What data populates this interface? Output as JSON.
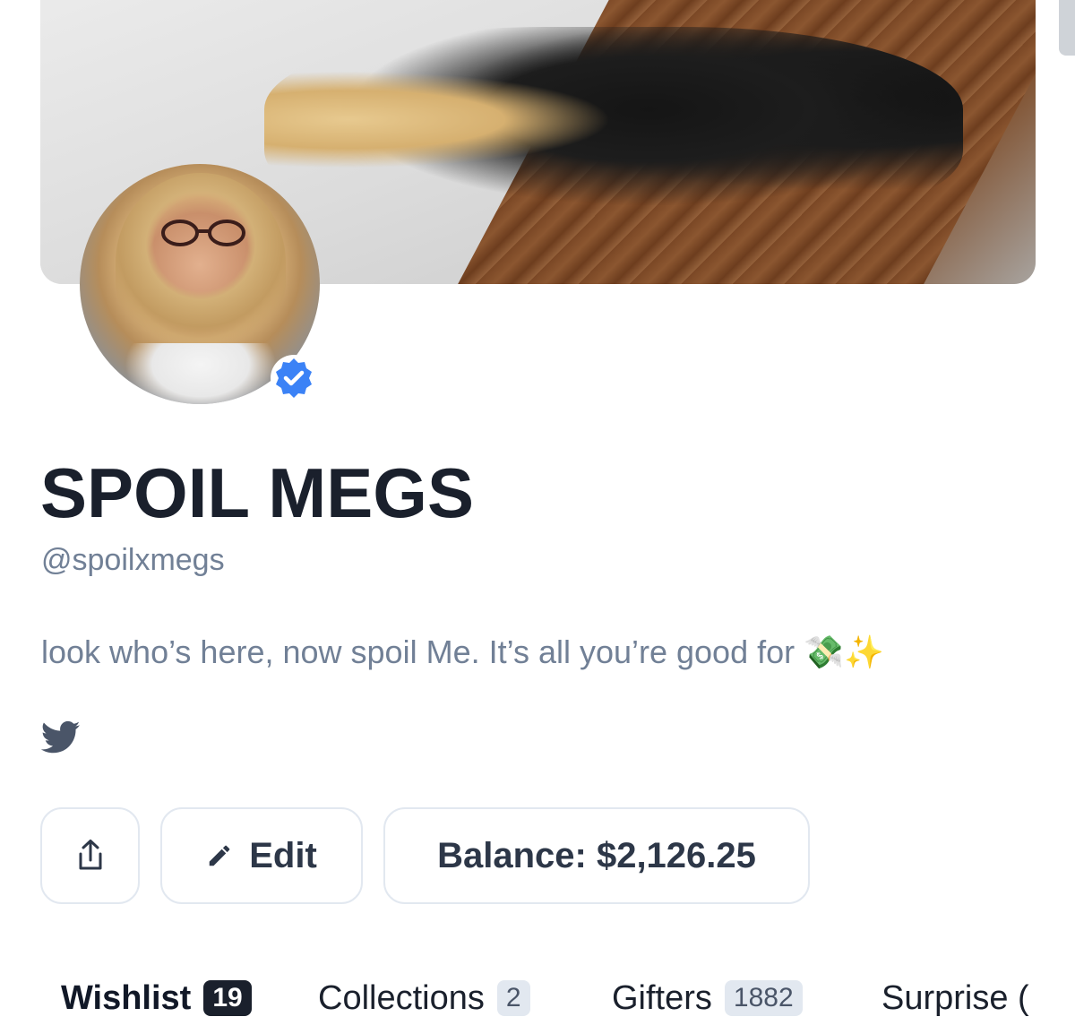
{
  "profile": {
    "name": "SPOIL MEGS",
    "handle": "@spoilxmegs",
    "bio": "look who’s here, now spoil Me. It’s all you’re good for 💸✨",
    "verified": true
  },
  "actions": {
    "share_icon": "share-icon",
    "edit_label": "Edit",
    "edit_icon": "pencil-icon",
    "balance_label": "Balance: $2,126.25"
  },
  "social": {
    "twitter_icon": "twitter-icon"
  },
  "tabs": [
    {
      "label": "Wishlist",
      "count": "19",
      "active": true
    },
    {
      "label": "Collections",
      "count": "2",
      "active": false
    },
    {
      "label": "Gifters",
      "count": "1882",
      "active": false
    },
    {
      "label": "Surprise (",
      "count": "",
      "active": false
    }
  ],
  "colors": {
    "text_primary": "#1a202c",
    "text_muted": "#718096",
    "border": "#e2e8f0",
    "verified_blue": "#3b82f6",
    "twitter_color": "#4a5568"
  }
}
